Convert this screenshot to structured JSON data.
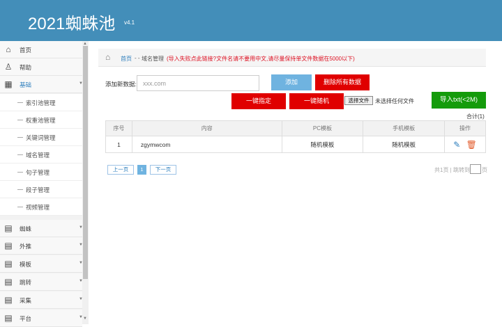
{
  "header": {
    "title": "2021蜘蛛池",
    "version": "v4.1"
  },
  "sidebar": {
    "items": [
      {
        "label": "首页",
        "icon": "home-icon",
        "glyph": "⌂"
      },
      {
        "label": "帮助",
        "icon": "user-icon",
        "glyph": "♙"
      },
      {
        "label": "基础",
        "icon": "grid-icon",
        "glyph": "▦",
        "expanded": true
      },
      {
        "label": "蜘蛛",
        "icon": "list-icon",
        "glyph": "▤"
      },
      {
        "label": "外推",
        "icon": "list-icon",
        "glyph": "▤"
      },
      {
        "label": "模板",
        "icon": "list-icon",
        "glyph": "▤"
      },
      {
        "label": "跳转",
        "icon": "list-icon",
        "glyph": "▤"
      },
      {
        "label": "采集",
        "icon": "list-icon",
        "glyph": "▤"
      },
      {
        "label": "平台",
        "icon": "list-icon",
        "glyph": "▤"
      }
    ],
    "subitems": [
      "索引池管理",
      "权重池管理",
      "关键词管理",
      "域名管理",
      "句子管理",
      "段子管理",
      "视频管理"
    ]
  },
  "breadcrumb": {
    "home": "首页",
    "sep": "- -",
    "current": "域名管理",
    "note": "(导入失败点此链接?文件名请不要用中文,请尽量保持单文件数据在5000以下)"
  },
  "form": {
    "add_label": "添加新数据:",
    "placeholder": "xxx.com",
    "add_button": "添加",
    "delete_all_button": "删除所有数据",
    "assign_button": "一键指定",
    "random_button": "一键随机",
    "file_button": "选择文件",
    "file_status": "未选择任何文件",
    "import_button": "导入txt(<2M)"
  },
  "table": {
    "total": "合计(1)",
    "headers": {
      "no": "序号",
      "content": "内容",
      "pc": "PC模板",
      "mobile": "手机模板",
      "op": "操作"
    },
    "rows": [
      {
        "no": "1",
        "content": "zgymwcom",
        "pc": "随机模板",
        "mobile": "随机模板"
      }
    ]
  },
  "pagination": {
    "prev": "上一页",
    "current": "1",
    "next": "下一页",
    "info": "共1页 | 跳转到",
    "page_suffix": "页"
  }
}
